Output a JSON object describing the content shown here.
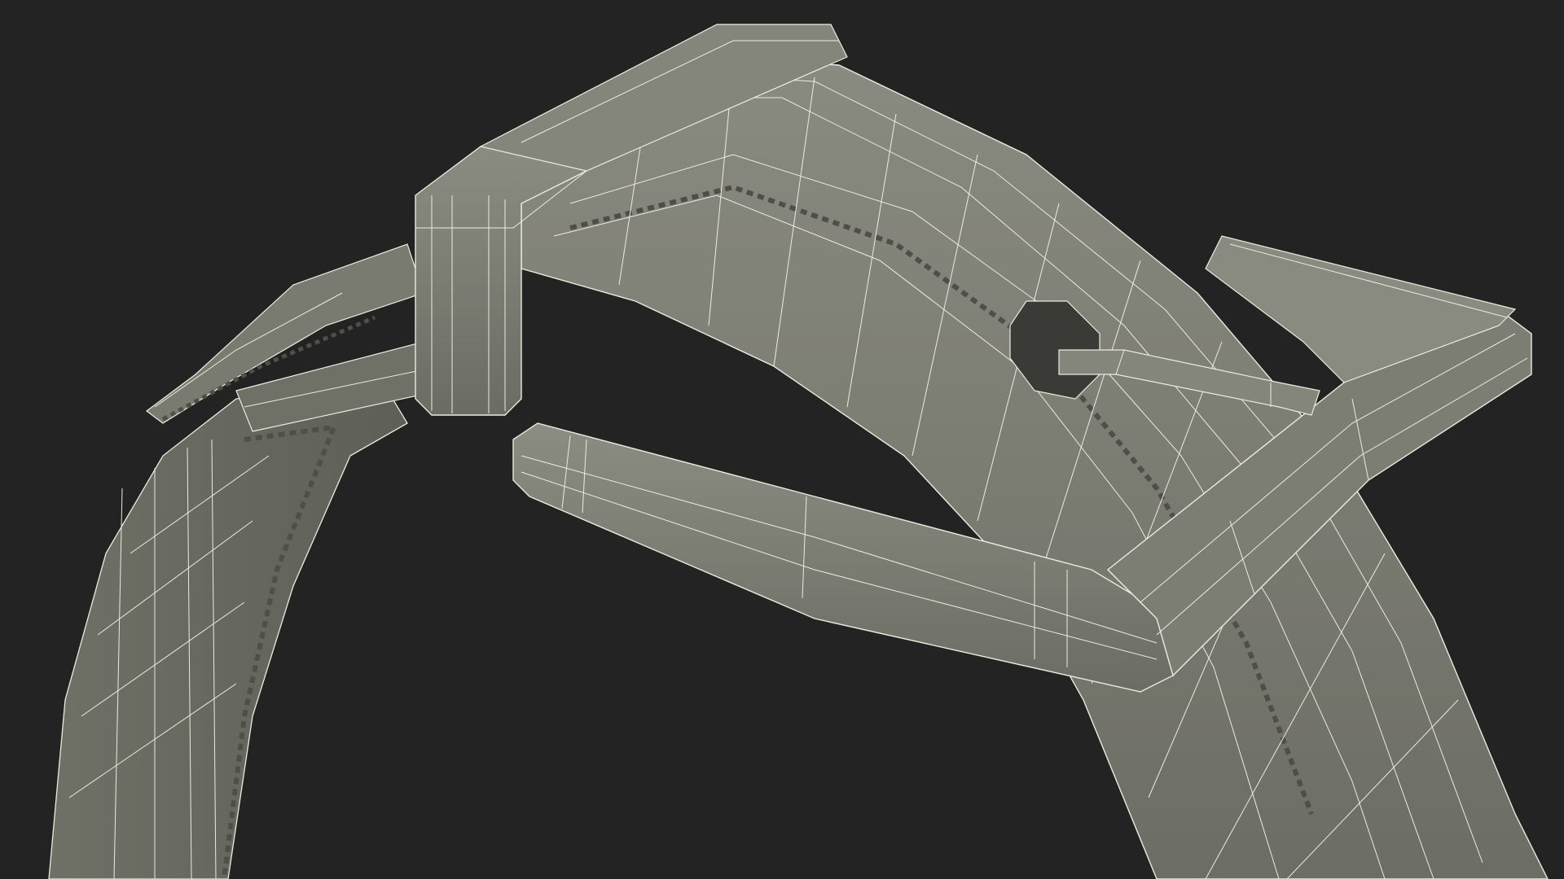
{
  "scene": {
    "subject": "wireframe-watch-strap-buckle-render",
    "colors": {
      "background": "#232323",
      "surface": "#7b7c71",
      "surface_light": "#8a8b80",
      "surface_dark": "#5f6058",
      "wire": "#ecebdf"
    }
  }
}
